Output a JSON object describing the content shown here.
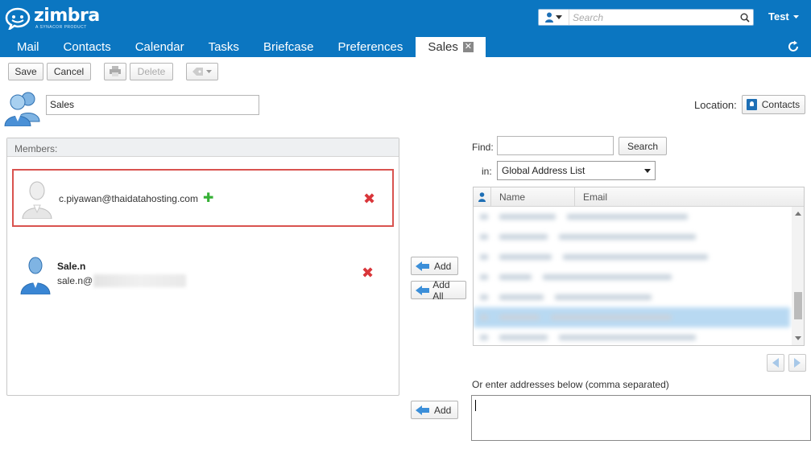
{
  "app": {
    "logo_text": "zimbra",
    "logo_subtext": "A SYNACOR PRODUCT",
    "search_placeholder": "Search",
    "user": "Test"
  },
  "tabs": [
    {
      "label": "Mail"
    },
    {
      "label": "Contacts"
    },
    {
      "label": "Calendar"
    },
    {
      "label": "Tasks"
    },
    {
      "label": "Briefcase"
    },
    {
      "label": "Preferences"
    },
    {
      "label": "Sales",
      "active": true,
      "closable": true
    }
  ],
  "toolbar": {
    "save": "Save",
    "cancel": "Cancel",
    "delete": "Delete"
  },
  "group": {
    "name": "Sales",
    "location_label": "Location:",
    "location_button": "Contacts"
  },
  "members": {
    "header": "Members:",
    "items": [
      {
        "email": "c.piyawan@thaidatahosting.com",
        "highlighted": true
      },
      {
        "name": "Sale.n",
        "email_prefix": "sale.n@"
      }
    ]
  },
  "middle": {
    "add": "Add",
    "add_all": "Add All",
    "add_bottom": "Add"
  },
  "find": {
    "find_label": "Find:",
    "search_button": "Search",
    "in_label": "in:",
    "source": "Global Address List",
    "columns": [
      "Name",
      "Email"
    ]
  },
  "manual": {
    "label": "Or enter addresses below (comma separated)"
  },
  "colors": {
    "header_bg": "#0b76c1",
    "highlight_border": "#d9534f",
    "remove_icon": "#d9363a",
    "add_icon": "#35b035",
    "selected_row": "#b8d9f2"
  }
}
